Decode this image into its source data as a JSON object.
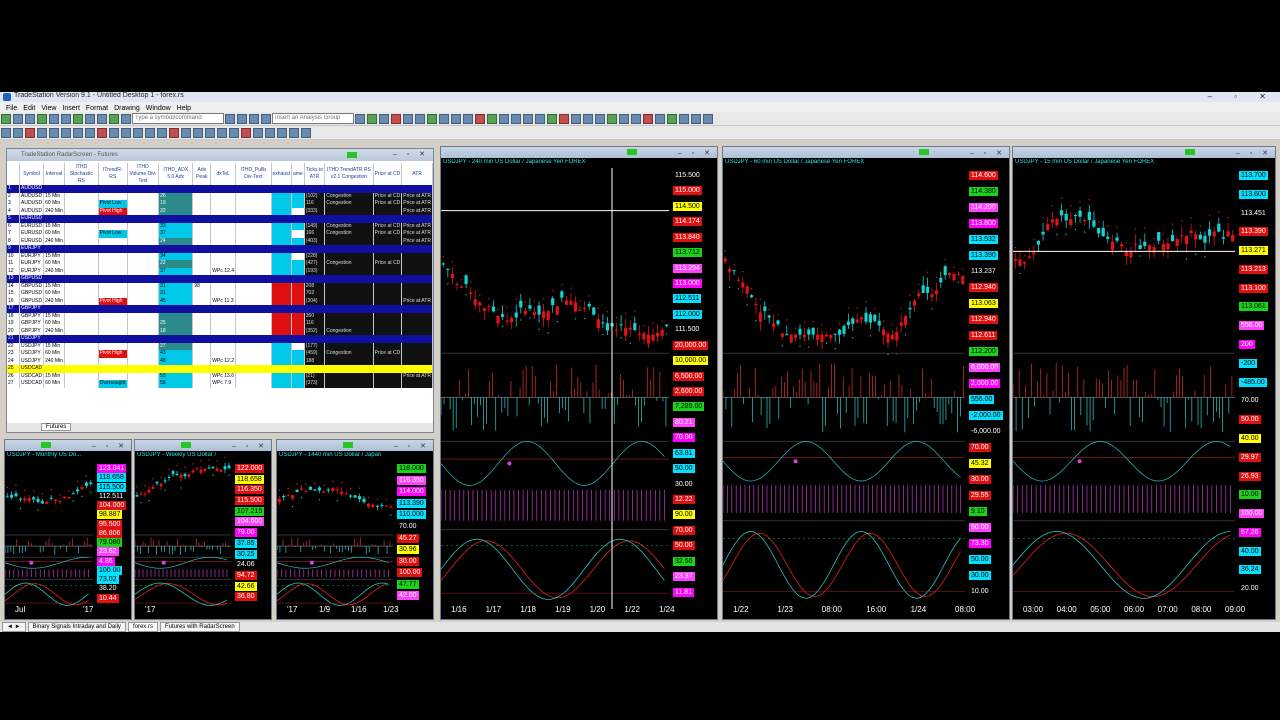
{
  "app": {
    "title": "TradeStation Version 9.1 - Untitled Desktop 1 - forex.rs",
    "menu": [
      "File",
      "Edit",
      "View",
      "Insert",
      "Format",
      "Drawing",
      "Window",
      "Help"
    ]
  },
  "toolbar": {
    "symbol_placeholder": "Type a symbol/command",
    "analysis_placeholder": "Insert an Analysis Group"
  },
  "radar": {
    "title": "TradeStation RadarScreen - Futures",
    "headers": [
      "Symbol",
      "Interval",
      "ITHD Stochastic RS",
      "ITrendR-RS",
      "ITHD Volume Div-Text",
      "ITHD_ADX 5.0 Adx",
      "Adx Peak",
      "dxTeL",
      "ITHD_Pullb Div-Text",
      "exhaust",
      "ame",
      "Ticks to ATR",
      "ITHD TrendATR RS v2.1 Congestion",
      "Price at CD",
      "ATR"
    ],
    "rows": [
      {
        "n": "1",
        "g": "AUDUSD"
      },
      {
        "n": "2",
        "s": "AUDUSD",
        "i": "15 Min",
        "adx": "26",
        "tk": "(102)",
        "c": "Congestion",
        "p": "Price at CD",
        "a": "Price at ATR"
      },
      {
        "n": "3",
        "s": "AUDUSD",
        "i": "60 Min",
        "t": "Pivot Low",
        "adx": "19",
        "tk": "116",
        "c": "Congestion",
        "p": "Price at CD",
        "a": "Price at ATR"
      },
      {
        "n": "4",
        "s": "AUDUSD",
        "i": "240 Min",
        "t": "Pivot High",
        "adx": "22",
        "tk": "(333)",
        "a": "Price at ATR"
      },
      {
        "n": "5",
        "g": "EURUSD"
      },
      {
        "n": "6",
        "s": "EURUSD",
        "i": "15 Min",
        "adx": "33",
        "tk": "(149)",
        "c": "Congestion",
        "p": "Price at CD",
        "a": "Price at ATR"
      },
      {
        "n": "7",
        "s": "EURUSD",
        "i": "60 Min",
        "t": "Pivot Low",
        "adx": "37",
        "tk": "166",
        "c": "Congestion",
        "p": "Price at CD",
        "a": "Price at ATR"
      },
      {
        "n": "8",
        "s": "EURUSD",
        "i": "240 Min",
        "adx": "24",
        "tk": "(403)",
        "a": "Price at ATR"
      },
      {
        "n": "9",
        "g": "EURJPY"
      },
      {
        "n": "10",
        "s": "EURJPY",
        "i": "15 Min",
        "adx": "34",
        "tk": "(228)"
      },
      {
        "n": "11",
        "s": "EURJPY",
        "i": "60 Min",
        "adx": "22",
        "tk": "(427)",
        "c": "Congestion",
        "p": "Price at CD"
      },
      {
        "n": "12",
        "s": "EURJPY",
        "i": "240 Min",
        "adx": "37",
        "dx": "WPc 12.4",
        "tk": "(193)"
      },
      {
        "n": "13",
        "g": "GBPUSD"
      },
      {
        "n": "14",
        "s": "GBPUSD",
        "i": "15 Min",
        "adx": "31",
        "pk": "98",
        "tk": "208"
      },
      {
        "n": "15",
        "s": "GBPUSD",
        "i": "60 Min",
        "adx": "31",
        "tk": "702"
      },
      {
        "n": "16",
        "s": "GBPUSD",
        "i": "240 Min",
        "t": "Pivot High",
        "adx": "45",
        "dx": "WPc 11.3",
        "tk": "(304)",
        "a": "Price at ATR"
      },
      {
        "n": "17",
        "g": "GBPJPY"
      },
      {
        "n": "18",
        "s": "GBPJPY",
        "i": "15 Min",
        "adx": "",
        "tk": "360"
      },
      {
        "n": "19",
        "s": "GBPJPY",
        "i": "60 Min",
        "adx": "25",
        "tk": "116"
      },
      {
        "n": "20",
        "s": "GBPJPY",
        "i": "240 Min",
        "adx": "18",
        "tk": "(352)",
        "c": "Congestion"
      },
      {
        "n": "21",
        "g": "USDJPY"
      },
      {
        "n": "22",
        "s": "USDJPY",
        "i": "15 Min",
        "adx": "27",
        "tk": "(177)"
      },
      {
        "n": "23",
        "s": "USDJPY",
        "i": "60 Min",
        "t": "Pivot High",
        "adx": "43",
        "tk": "(459)",
        "c": "Congestion",
        "p": "Price at CD"
      },
      {
        "n": "24",
        "s": "USDJPY",
        "i": "240 Min",
        "adx": "48",
        "dx": "WPc 12.2",
        "tk": "188"
      },
      {
        "n": "25",
        "g": "USDCAD",
        "cur": true
      },
      {
        "n": "26",
        "s": "USDCAD",
        "i": "15 Min",
        "adx": "53",
        "dx": "WPc 13.6",
        "tk": "(21)",
        "a": "Price at ATR"
      },
      {
        "n": "27",
        "s": "USDCAD",
        "i": "60 Min",
        "t": "Oversought",
        "adx": "58",
        "dx": "WPc 7.9",
        "tk": "(373)"
      }
    ],
    "sheet_tab": "Futures"
  },
  "charts": {
    "monthly": {
      "title": "USDJPY - Monthly  US Do...",
      "prices": [
        "123.041",
        "118.658",
        "115.500",
        "112.511",
        "104.000",
        "98.887",
        "95.500",
        "86.806",
        "79.080",
        "23.62",
        "4.86",
        "100.00",
        "73.02",
        "38.20",
        "10.44"
      ],
      "x": [
        "Jul",
        "'17"
      ]
    },
    "weekly": {
      "title": "USDJPY - Weekly  US Dollar /",
      "prices": [
        "122.000",
        "118.658",
        "116.350",
        "115.500",
        "107.215",
        "104.600",
        "79.00",
        "37.85",
        "30.25",
        "24.06",
        "94.72",
        "42.66",
        "36.80"
      ],
      "x": [
        "'17"
      ]
    },
    "daily": {
      "title": "USDJPY - 1440 min  US Dollar / Japan",
      "prices": [
        "118.000",
        "116.350",
        "114.000",
        "113.390",
        "110.000",
        "70.00",
        "45.27",
        "30.96",
        "30.00",
        "100.00",
        "47.77",
        "42.00"
      ],
      "x": [
        "'17",
        "1/9",
        "1/16",
        "1/23"
      ]
    },
    "m240": {
      "title": "USDJPY - 240 min  US Dollar / Japanese Yen  FOREX",
      "prices": [
        "115.500",
        "115.000",
        "114.500",
        "114.174",
        "113.840",
        "113.712",
        "113.294",
        "113.000",
        "112.511",
        "112.000",
        "111.500",
        "20,000.00",
        "10,000.00",
        "6,500.00",
        "2,600.00",
        "7,289.00",
        "80.21",
        "70.00",
        "63.81",
        "50.00",
        "30.00",
        "12.22",
        "90.00",
        "70.00",
        "50.00",
        "32.56",
        "23.37",
        "11.81"
      ],
      "x": [
        "1/16",
        "1/17",
        "1/18",
        "1/19",
        "1/20",
        "1/22",
        "1/24"
      ]
    },
    "m60": {
      "title": "USDJPY - 60 min  US Dollar / Japanese Yen  FOREX",
      "prices": [
        "114.600",
        "114.380",
        "114.200",
        "113.800",
        "113.532",
        "113.390",
        "113.237",
        "112.940",
        "113.063",
        "112.940",
        "112.611",
        "112.200",
        "6,000.00",
        "2,000.00",
        "556.00",
        "-2,000.00",
        "-6,000.00",
        "70.00",
        "45.32",
        "30.00",
        "29.55",
        "9.10",
        "90.00",
        "73.30",
        "50.00",
        "30.00",
        "10.00"
      ],
      "x": [
        "1/22",
        "1/23",
        "08:00",
        "16:00",
        "1/24",
        "08:00"
      ]
    },
    "m15": {
      "title": "USDJPY - 15 min  US Dollar / Japanese Yen  FOREX",
      "prices": [
        "113.700",
        "113.600",
        "113.451",
        "113.390",
        "113.271",
        "113.213",
        "113.100",
        "113.061",
        "556.00",
        "200",
        "-200",
        "-485.00",
        "70.00",
        "50.00",
        "40.00",
        "29.97",
        "26.93",
        "10.00",
        "100.00",
        "67.26",
        "40.00",
        "36.24",
        "20.00"
      ],
      "x": [
        "03:00",
        "04:00",
        "05:00",
        "06:00",
        "07:00",
        "08:00",
        "09:00"
      ]
    }
  },
  "bottom_tabs": [
    "Binary Signals Intraday and Daily",
    "forex.rs",
    "Futures with RadarScreen"
  ],
  "colors": {
    "up": "#17d2d2",
    "down": "#e01414",
    "dots_red": "#e02020",
    "dots_teal": "#17c8a8",
    "panel": "#000000",
    "chrome": "#d4d0c8"
  }
}
